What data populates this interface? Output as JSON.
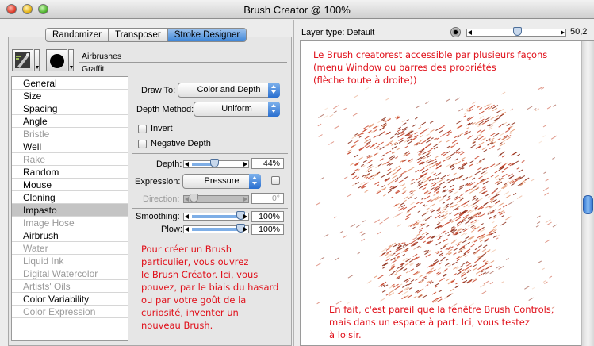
{
  "window": {
    "title": "Brush Creator @ 100%"
  },
  "tabs": [
    {
      "label": "Randomizer",
      "active": false
    },
    {
      "label": "Transposer",
      "active": false
    },
    {
      "label": "Stroke Designer",
      "active": true
    }
  ],
  "brush": {
    "category": "Airbrushes",
    "variant": "Graffiti"
  },
  "sections": [
    {
      "label": "General",
      "enabled": true,
      "selected": false
    },
    {
      "label": "Size",
      "enabled": true,
      "selected": false
    },
    {
      "label": "Spacing",
      "enabled": true,
      "selected": false
    },
    {
      "label": "Angle",
      "enabled": true,
      "selected": false
    },
    {
      "label": "Bristle",
      "enabled": false,
      "selected": false
    },
    {
      "label": "Well",
      "enabled": true,
      "selected": false
    },
    {
      "label": "Rake",
      "enabled": false,
      "selected": false
    },
    {
      "label": "Random",
      "enabled": true,
      "selected": false
    },
    {
      "label": "Mouse",
      "enabled": true,
      "selected": false
    },
    {
      "label": "Cloning",
      "enabled": true,
      "selected": false
    },
    {
      "label": "Impasto",
      "enabled": true,
      "selected": true
    },
    {
      "label": "Image Hose",
      "enabled": false,
      "selected": false
    },
    {
      "label": "Airbrush",
      "enabled": true,
      "selected": false
    },
    {
      "label": "Water",
      "enabled": false,
      "selected": false
    },
    {
      "label": "Liquid Ink",
      "enabled": false,
      "selected": false
    },
    {
      "label": "Digital Watercolor",
      "enabled": false,
      "selected": false
    },
    {
      "label": "Artists' Oils",
      "enabled": false,
      "selected": false
    },
    {
      "label": "Color Variability",
      "enabled": true,
      "selected": false
    },
    {
      "label": "Color Expression",
      "enabled": false,
      "selected": false
    }
  ],
  "impasto": {
    "draw_to_label": "Draw To:",
    "draw_to_value": "Color and Depth",
    "depth_method_label": "Depth Method:",
    "depth_method_value": "Uniform",
    "invert_label": "Invert",
    "negative_depth_label": "Negative Depth",
    "depth_label": "Depth:",
    "depth_value": "44%",
    "depth_fraction": 0.44,
    "expression_label": "Expression:",
    "expression_value": "Pressure",
    "direction_label": "Direction:",
    "direction_value": "0°",
    "direction_fraction": 0.0,
    "smoothing_label": "Smoothing:",
    "smoothing_value": "100%",
    "smoothing_fraction": 1.0,
    "plow_label": "Plow:",
    "plow_value": "100%",
    "plow_fraction": 1.0
  },
  "preview": {
    "layer_type_label": "Layer type: Default",
    "opacity_value": "50,2",
    "opacity_fraction": 0.5
  },
  "annotations": {
    "left_note": [
      "Pour créer un Brush",
      "particulier, vous ouvrez",
      "le Brush Créator. Ici, vous",
      "pouvez, par le biais du hasard",
      "ou par votre goût de la",
      "curiosité, inventer un",
      "nouveau Brush."
    ],
    "top_note": [
      "Le Brush creatorest accessible par plusieurs façons",
      "(menu Window ou barres des propriétés",
      "(flèche toute à droite))"
    ],
    "bottom_note": [
      "En fait, c'est pareil que la fenêtre Brush Controls,",
      "mais dans un espace à part. Ici, vous testez",
      "à loisir."
    ]
  },
  "colors": {
    "annotation_red": "#e0101a",
    "accent_blue": "#3f86d8",
    "stroke_red": "#c8442a"
  },
  "icons": [
    "airbrush-category-icon",
    "round-dab-icon",
    "dropdown-arrow-icon",
    "opacity-icon"
  ]
}
